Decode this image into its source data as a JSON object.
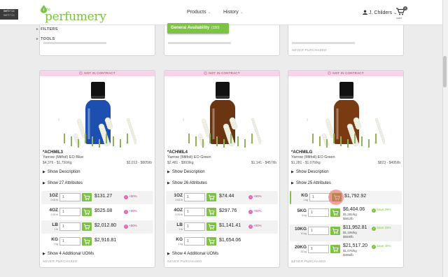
{
  "metric": [
    "metric",
    "metric"
  ],
  "logo": {
    "the": "the",
    "name": "perfumery"
  },
  "nav": {
    "products": "Products",
    "history": "History"
  },
  "user": "J. Childers",
  "cart": {
    "count": "0",
    "label": "CART"
  },
  "dropdown": {
    "label": "General Availability",
    "count": "(150)"
  },
  "filters": {
    "filters": "FILTERS",
    "tools": "TOOLS"
  },
  "top_cards": [
    {
      "status": ""
    },
    {
      "status": ""
    },
    {
      "status": "NEVER PURCHASED"
    }
  ],
  "cards": [
    {
      "banner": "NOT IN CONTRACT",
      "bottle": "#1c4fb0",
      "code": "*ACHMIL3",
      "name": "Yarrow (Milfoil) EO Blue",
      "price_left": "$4,376 - $1,750/kg",
      "price_right": "$2,013 - $805/lb",
      "show_desc": "Show Description",
      "show_attr": "Show 27 Attributes",
      "uoms": [
        {
          "unit": "1OZ",
          "sub": "0.06 lb",
          "qty": "1",
          "price": "$131.27",
          "pct": "+50%"
        },
        {
          "unit": "4OZ",
          "sub": "0.25 lb",
          "qty": "1",
          "price": "$525.08",
          "pct": "+50%"
        },
        {
          "unit": "LB",
          "sub": "1 lb",
          "qty": "1",
          "price": "$2,012.80",
          "pct": "+50%"
        },
        {
          "unit": "KG",
          "sub": "1 kg",
          "qty": "1",
          "price": "$2,916.81",
          "pct": ""
        }
      ],
      "more": "Show 4 Additional UOMs",
      "never": "NEVER PURCHASED"
    },
    {
      "banner": "NOT IN CONTRACT",
      "bottle": "#6a3510",
      "code": "*ACHMIL4",
      "name": "Yarrow (Milfoil) EO Green",
      "price_left": "$2,481 - $993/kg",
      "price_right": "$1,141 - $457/lb",
      "show_desc": "Show Description",
      "show_attr": "Show 26 Attributes",
      "uoms": [
        {
          "unit": "1OZ",
          "sub": "0.06 lb",
          "qty": "1",
          "price": "$74.44",
          "pct": "+50%"
        },
        {
          "unit": "4OZ",
          "sub": "0.25 lb",
          "qty": "1",
          "price": "$297.76",
          "pct": "+50%"
        },
        {
          "unit": "LB",
          "sub": "1 lb",
          "qty": "1",
          "price": "$1,141.41",
          "pct": "+50%"
        },
        {
          "unit": "KG",
          "sub": "1 kg",
          "qty": "1",
          "price": "$1,654.06",
          "pct": ""
        }
      ],
      "more": "Show 4 Additional UOMs",
      "never": "NEVER PURCHASED"
    },
    {
      "banner": "NOT IN CONTRACT",
      "bottle": "#7a3a12",
      "code": "*ACHMILG",
      "name": "Yarrow (Milfoil) EO Green",
      "price_left": "$1,281 - $1,076/kg",
      "price_right": "$823 - $495/lb",
      "show_desc": "Show Description",
      "show_attr": "Show 25 Attributes",
      "uoms": [
        {
          "unit": "KG",
          "sub": "1 kg",
          "qty": "1",
          "price": "$1,792.92",
          "lines": [],
          "save": ""
        },
        {
          "unit": "5KG",
          "sub": "5 kg",
          "qty": "1",
          "price": "$6,404.06",
          "lines": [
            "$1,281/kg",
            "$581/lb"
          ],
          "save": "Save 29%"
        },
        {
          "unit": "10KG",
          "sub": "10 kg",
          "qty": "1",
          "price": "$11,952.81",
          "lines": [
            "$1,195/kg",
            "$559/lb"
          ],
          "save": "Save 33%"
        },
        {
          "unit": "20KG",
          "sub": "20 kg",
          "qty": "1",
          "price": "$21,517.20",
          "lines": [
            "$1,076/kg",
            "$495/lb"
          ],
          "save": "Save 40%"
        }
      ],
      "never": "NEVER PURCHASED"
    }
  ]
}
